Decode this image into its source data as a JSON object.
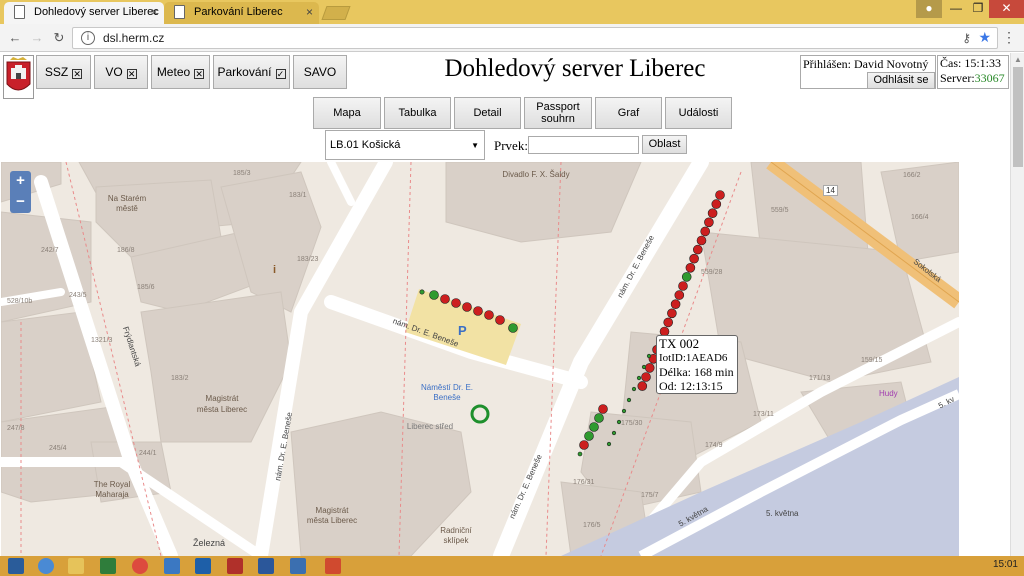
{
  "browser": {
    "tabs": [
      {
        "title": "Dohledový server Liberec",
        "close": "×"
      },
      {
        "title": "Parkování Liberec",
        "close": "×"
      }
    ],
    "url": "dsl.herm.cz",
    "window_buttons": {
      "min": "—",
      "max": "❐",
      "close": "✕"
    }
  },
  "header": {
    "title": "Dohledový server Liberec",
    "module_buttons": [
      {
        "label": "SSZ",
        "checked": false
      },
      {
        "label": "VO",
        "checked": false
      },
      {
        "label": "Meteo",
        "checked": false
      },
      {
        "label": "Parkování",
        "checked": true
      },
      {
        "label": "SAVO"
      }
    ],
    "user": {
      "label": "Přihlášen: David Novotný",
      "logout": "Odhlásit se"
    },
    "time": {
      "cas_label": "Čas:",
      "cas_value": "15:1:33",
      "server_label": "Server:",
      "server_value": "33067"
    }
  },
  "views": {
    "mapa": "Mapa",
    "tabulka": "Tabulka",
    "detail": "Detail",
    "passport": "Passport souhrn",
    "graf": "Graf",
    "udalosti": "Události"
  },
  "filter": {
    "selected": "LB.01 Košická",
    "prvek_label": "Prvek:",
    "prvek_value": "",
    "oblast": "Oblast"
  },
  "map": {
    "zoom_in": "+",
    "zoom_out": "−",
    "labels": {
      "divadlo": "Divadlo F. X. Šaldy",
      "na_starem_meste": "Na Starém městě",
      "magistrat": "Magistrát města Liberec",
      "magistrat2": "Magistrát města Liberec",
      "namesti": "Náměstí Dr. E. Beneše",
      "liberec_stred": "Liberec střed",
      "the_royal": "The Royal Maharaja",
      "radnicni": "Radniční sklípek",
      "hudy": "Hudy",
      "frydlantska": "Frýdlantská",
      "zelezna": "Železná",
      "sokolska": "Sokolská",
      "kvetna": "5. května",
      "kvetna2": "5. května",
      "kvetna3": "5. kv",
      "benese1": "nám. Dr. E. Beneše",
      "benese2": "nám. Dr. E. Beneše",
      "benese3": "nám. Dr. E. Beneše",
      "benese4": "nám. Dr. E. Beneše",
      "road14": "14",
      "parking_p": "P",
      "info_i": "i",
      "house_numbers": [
        "185/3",
        "183/1",
        "183/23",
        "186/8",
        "185/6",
        "242/7",
        "243/5",
        "528/10b",
        "1321/3",
        "183/2",
        "247/8",
        "245/4",
        "244/1",
        "559/5",
        "166/4",
        "559/28",
        "166/2",
        "159/15",
        "171/13",
        "173/11",
        "174/9",
        "175/30",
        "176/31",
        "175/7",
        "176/5"
      ]
    },
    "tooltip": {
      "title": "TX 002",
      "iot": "IotID:1AEAD6",
      "delka": "Délka: 168 min",
      "od": "Od: 12:13:15"
    }
  },
  "taskbar": {
    "clock": "15:01"
  },
  "colors": {
    "occupied": "#cc1f1f",
    "free": "#2f9a2f",
    "chrome_tabbar": "#e8c75f",
    "taskbar": "#d8a03a"
  }
}
